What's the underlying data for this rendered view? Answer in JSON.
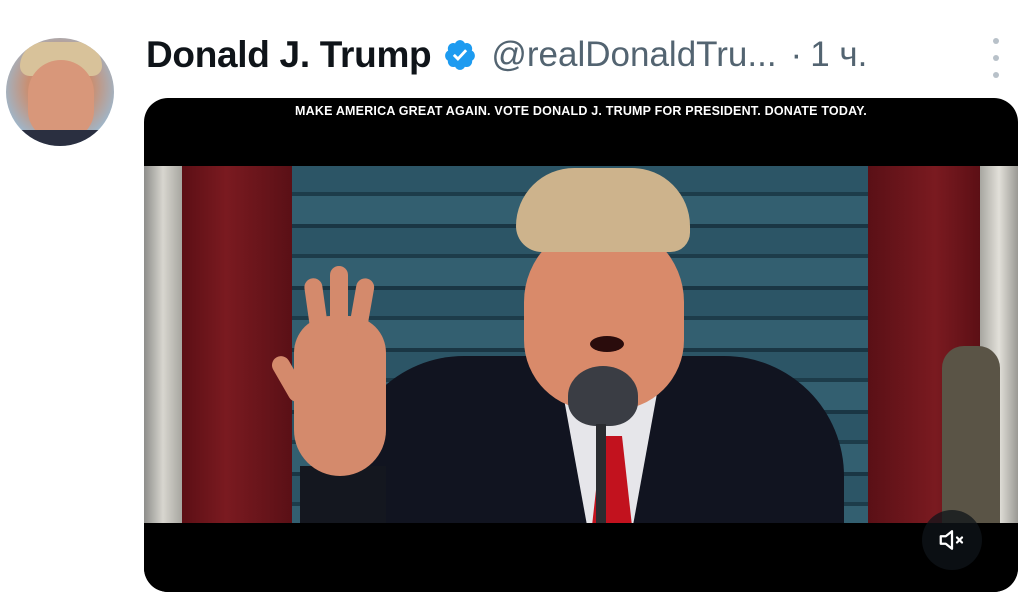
{
  "tweet": {
    "author": {
      "display_name": "Donald J. Trump",
      "handle": "@realDonaldTru...",
      "verified": true,
      "avatar": "profile-photo"
    },
    "separator": "·",
    "timestamp": "1 ч.",
    "more_icon": "more-vertical-icon",
    "media": {
      "type": "video",
      "banner_text": "MAKE AMERICA GREAT AGAIN. VOTE DONALD J. TRUMP FOR PRESIDENT. DONATE TODAY.",
      "mute_icon": "volume-muted-icon"
    }
  },
  "colors": {
    "name": "#0f1419",
    "secondary_text": "#536471",
    "verified_badge": "#1d9bf0",
    "media_bg": "#000000"
  }
}
